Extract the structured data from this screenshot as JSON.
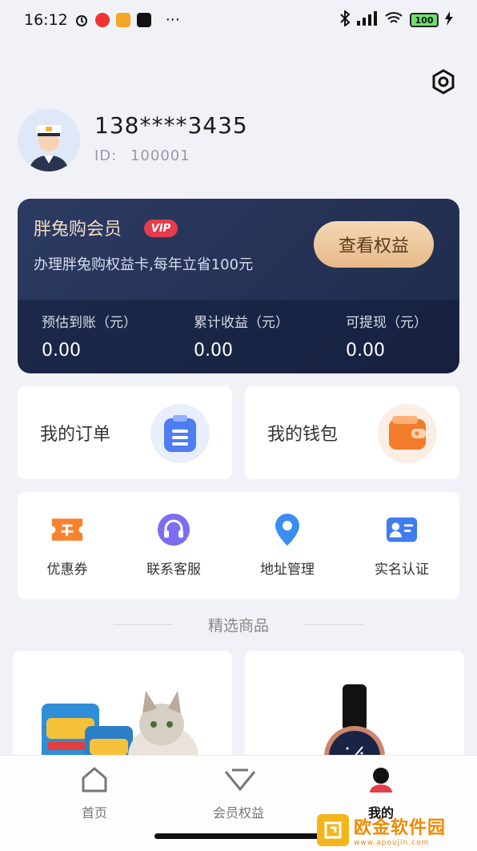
{
  "status_bar": {
    "time": "16:12",
    "dots": "···",
    "battery": "100"
  },
  "profile": {
    "phone": "138****3435",
    "id_label": "ID:",
    "id_value": "100001"
  },
  "member": {
    "title": "胖兔购会员",
    "badge": "VIP",
    "description": "办理胖兔购权益卡,每年立省100元",
    "button": "查看权益",
    "stats": [
      {
        "label": "预估到账（元）",
        "value": "0.00"
      },
      {
        "label": "累计收益（元）",
        "value": "0.00"
      },
      {
        "label": "可提现（元）",
        "value": "0.00"
      }
    ]
  },
  "quick": {
    "orders": "我的订单",
    "wallet": "我的钱包"
  },
  "services": [
    {
      "label": "优惠券",
      "icon": "coupon-icon"
    },
    {
      "label": "联系客服",
      "icon": "headset-icon"
    },
    {
      "label": "地址管理",
      "icon": "location-icon"
    },
    {
      "label": "实名认证",
      "icon": "id-card-icon"
    }
  ],
  "section": {
    "title": "精选商品"
  },
  "tabs": [
    {
      "label": "首页",
      "icon": "home-icon",
      "active": false
    },
    {
      "label": "会员权益",
      "icon": "vip-icon",
      "active": false
    },
    {
      "label": "我的",
      "icon": "profile-icon",
      "active": true
    }
  ],
  "watermark": {
    "text": "欧金软件园",
    "url": "www.apoujin.com"
  },
  "colors": {
    "accent_card": "#25345a",
    "gold_button": "#ecc79e",
    "vip_badge": "#e53d4a",
    "wallet_orange": "#f27b2c",
    "order_blue": "#4f7cf3"
  }
}
